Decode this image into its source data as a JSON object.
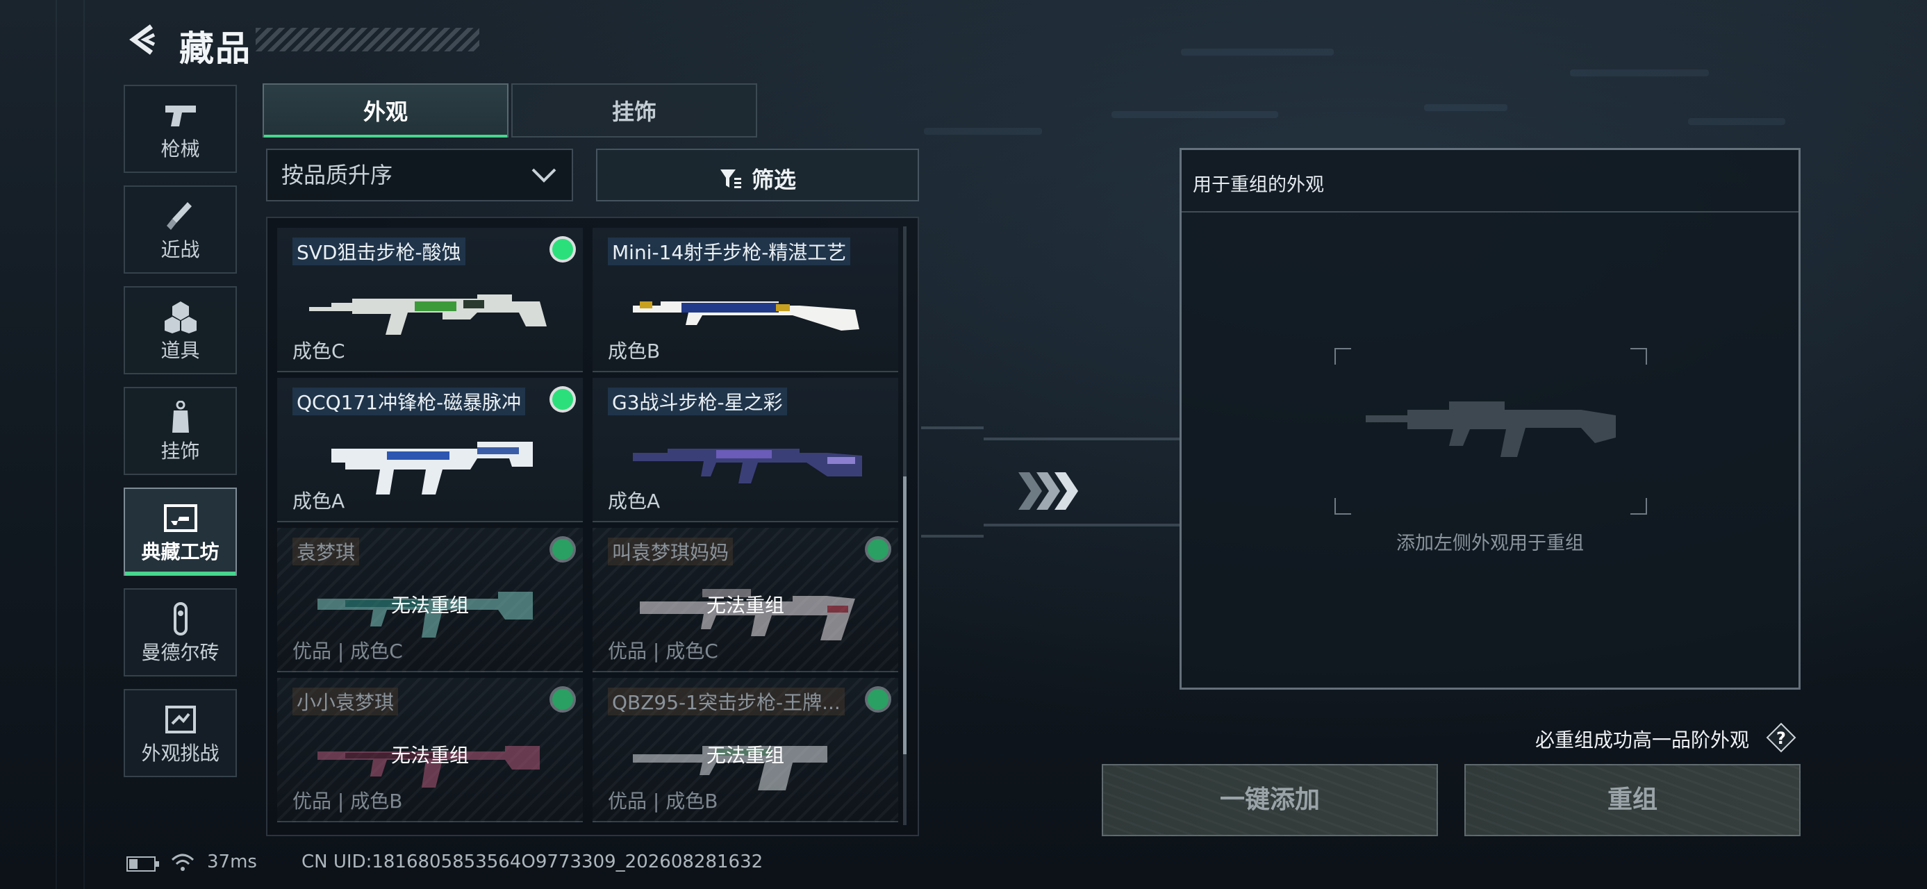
{
  "header": {
    "title": "藏品"
  },
  "sidebar": {
    "items": [
      {
        "label": "枪械",
        "icon": "pistol-icon"
      },
      {
        "label": "近战",
        "icon": "knife-icon"
      },
      {
        "label": "道具",
        "icon": "cubes-icon"
      },
      {
        "label": "挂饰",
        "icon": "charm-tag-icon"
      },
      {
        "label": "典藏工坊",
        "icon": "workshop-frame-icon",
        "active": true
      },
      {
        "label": "曼德尔砖",
        "icon": "mandel-brick-icon"
      },
      {
        "label": "外观挑战",
        "icon": "challenge-icon"
      }
    ]
  },
  "tabs": {
    "appearance": "外观",
    "charms": "挂饰"
  },
  "sort": {
    "value": "按品质升序"
  },
  "filter": {
    "label": "筛选"
  },
  "skins": [
    {
      "name": "SVD狙击步枪-酸蚀",
      "grade": "成色C",
      "selectable": true
    },
    {
      "name": "Mini-14射手步枪-精湛工艺",
      "grade": "成色B",
      "selectable": true
    },
    {
      "name": "QCQ171冲锋枪-磁暴脉冲",
      "grade": "成色A",
      "selectable": true
    },
    {
      "name": "G3战斗步枪-星之彩",
      "grade": "成色A",
      "selectable": true
    },
    {
      "name": "袁梦琪",
      "grade": "优品 | 成色C",
      "selectable": false,
      "status": "无法重组"
    },
    {
      "name": "叫袁梦琪妈妈",
      "grade": "优品 | 成色C",
      "selectable": false,
      "status": "无法重组"
    },
    {
      "name": "小小袁梦琪",
      "grade": "优品 | 成色B",
      "selectable": false,
      "status": "无法重组"
    },
    {
      "name": "QBZ95-1突击步枪-王牌...",
      "grade": "优品 | 成色B",
      "selectable": false,
      "status": "无法重组"
    }
  ],
  "recombine": {
    "panel_title": "用于重组的外观",
    "hint": "添加左侧外观用于重组",
    "guarantee": "必重组成功高一品阶外观",
    "one_click_add": "一键添加",
    "recombine": "重组"
  },
  "status_bar": {
    "ping": "37ms",
    "uid": "CN UID:1816805853564O9773309_202608281632"
  },
  "colors": {
    "accent": "#48d58e",
    "selected_dot": "#2be07b"
  }
}
